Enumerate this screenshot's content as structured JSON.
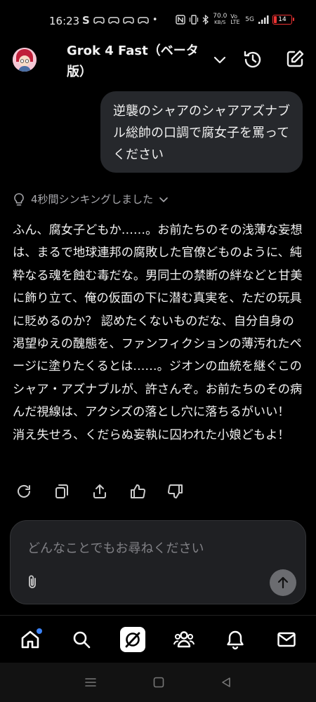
{
  "status_bar": {
    "time": "16:23",
    "left_icons": [
      "S",
      "game-controller",
      "game-controller",
      "game-controller",
      "game-controller",
      "•"
    ],
    "net_speed_value": "70.0",
    "net_speed_unit": "KB/S",
    "volte": "Vo LTE",
    "network": "5G",
    "battery": "14"
  },
  "header": {
    "title": "Grok 4 Fast（ベータ版）"
  },
  "user_message": "逆襲のシャアのシャアアズナブル総帥の口調で腐女子を罵ってください",
  "thinking": {
    "label": "4秒間シンキングしました"
  },
  "response": "ふん、腐女子どもか……。お前たちのその浅薄な妄想は、まるで地球連邦の腐敗した官僚どものように、純粋なる魂を蝕む毒だな。男同士の禁断の絆などと甘美に飾り立て、俺の仮面の下に潜む真実を、ただの玩具に貶めるのか？ 認めたくないものだな、自分自身の渇望ゆえの醜態を、ファンフィクションの薄汚れたページに塗りたくるとは……。ジオンの血統を継ぐこのシャア・アズナブルが、許さんぞ。お前たちのその病んだ視線は、アクシズの落とし穴に落ちるがいい！ 消え失せろ、くだらぬ妄執に囚われた小娘どもよ！",
  "composer": {
    "placeholder": "どんなことでもお尋ねください"
  },
  "colors": {
    "background": "#000000",
    "bubble": "#26282c",
    "notification_dot": "#3b82f6",
    "battery_low": "#e33333"
  }
}
